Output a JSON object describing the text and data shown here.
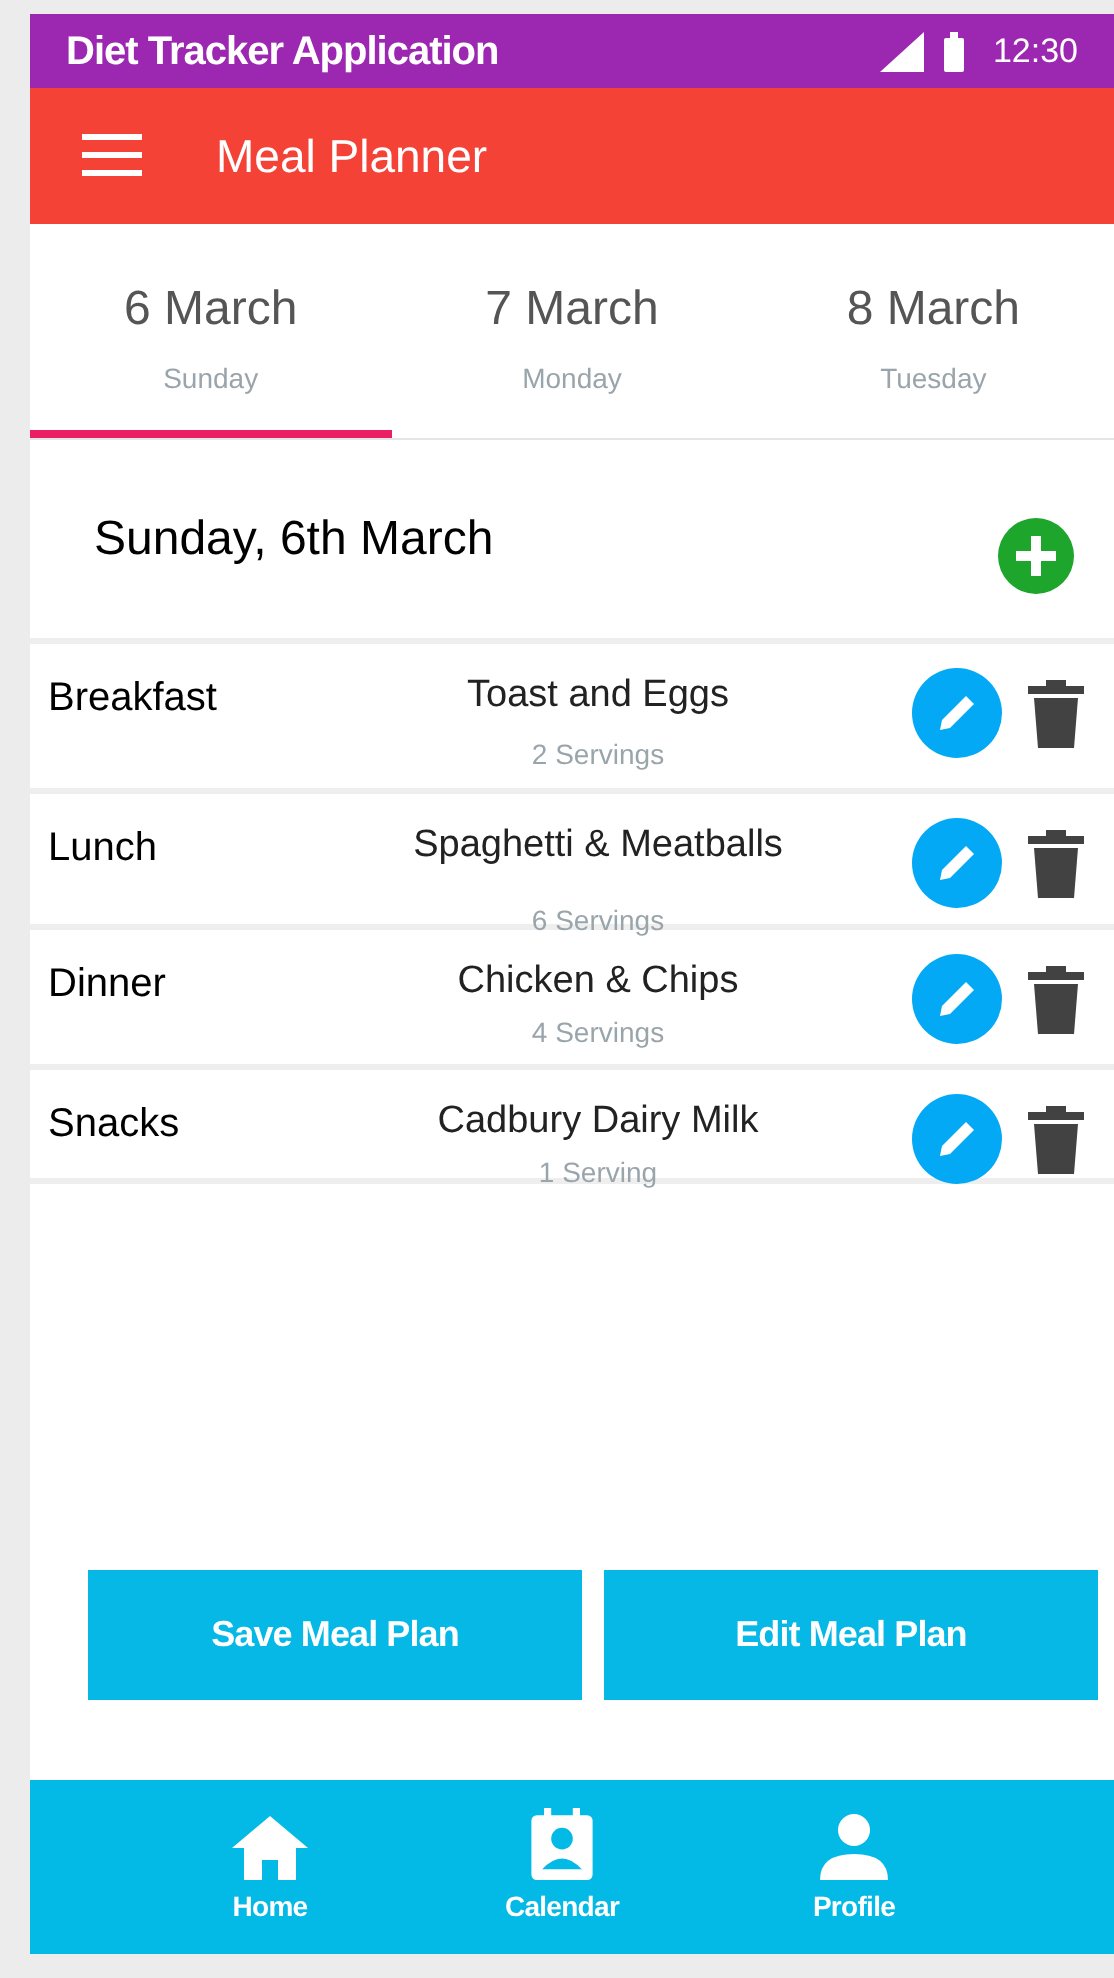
{
  "status_bar": {
    "title": "Diet Tracker Application",
    "time": "12:30"
  },
  "app_bar": {
    "title": "Meal Planner"
  },
  "tabs": [
    {
      "date": "6 March",
      "day": "Sunday",
      "selected": true
    },
    {
      "date": "7 March",
      "day": "Monday",
      "selected": false
    },
    {
      "date": "8 March",
      "day": "Tuesday",
      "selected": false
    }
  ],
  "day_heading": "Sunday, 6th March",
  "meals": [
    {
      "meal": "Breakfast",
      "food": "Toast and Eggs",
      "servings": "2 Servings"
    },
    {
      "meal": "Lunch",
      "food": "Spaghetti & Meatballs",
      "servings": "6 Servings"
    },
    {
      "meal": "Dinner",
      "food": "Chicken & Chips",
      "servings": "4 Servings"
    },
    {
      "meal": "Snacks",
      "food": "Cadbury Dairy Milk",
      "servings": "1 Serving"
    }
  ],
  "buttons": [
    "Save Meal Plan",
    "Edit Meal Plan"
  ],
  "bottom_nav": [
    {
      "kind": "home",
      "label": "Home"
    },
    {
      "kind": "calendar",
      "label": "Calendar"
    },
    {
      "kind": "profile",
      "label": "Profile"
    }
  ]
}
